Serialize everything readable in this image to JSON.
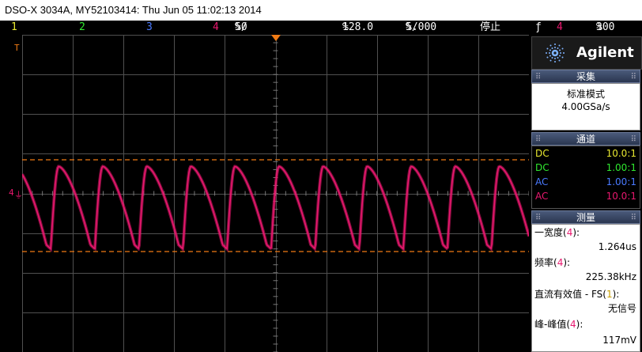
{
  "window": {
    "title": "DSO-X 3034A, MY52103414: Thu Jun 05 11:02:13 2014"
  },
  "status": {
    "ch1": "1",
    "ch2": "2",
    "ch3": "3",
    "ch4": "4",
    "ch4_scale": "50",
    "ch4_scale_unit": "%/",
    "time_delay": "128.0",
    "time_delay_unit": "%",
    "time_scale": "5.000",
    "time_scale_unit": "%/",
    "run_state": "停止",
    "trigger_symbol": "ƒ",
    "trigger_channel": "4",
    "trigger_level": "300",
    "trigger_level_unit": "%"
  },
  "colors": {
    "ch1": "#e8e830",
    "ch2": "#30e830",
    "ch3": "#4a7aff",
    "ch4": "#e8186e",
    "cursor": "#f07a14",
    "grid": "#505050"
  },
  "panel": {
    "brand": "Agilent",
    "acquire": {
      "header": "采集",
      "mode": "标准模式",
      "rate": "4.00GSa/s"
    },
    "channels": {
      "header": "通道",
      "rows": [
        {
          "coupling": "DC",
          "probe": "10.0:1"
        },
        {
          "coupling": "DC",
          "probe": "1.00:1"
        },
        {
          "coupling": "AC",
          "probe": "1.00:1"
        },
        {
          "coupling": "AC",
          "probe": "10.0:1"
        }
      ]
    },
    "measure": {
      "header": "测量",
      "items": [
        {
          "name": "一宽度(",
          "ch": "4",
          "close": "):",
          "value": "1.264us"
        },
        {
          "name": "频率(",
          "ch": "4",
          "close": "):",
          "value": "225.38kHz"
        },
        {
          "name": "直流有效值 - FS(",
          "ch": "1",
          "close": "):",
          "value": "无信号"
        },
        {
          "name": "峰-峰值(",
          "ch": "4",
          "close": "):",
          "value": "117mV"
        }
      ]
    }
  },
  "waveform": {
    "channel": "4",
    "description_cycles": 11.5,
    "peak_fraction": 0.58,
    "trough_fraction": 0.96
  },
  "markers": {
    "trigger_t": "T",
    "ground_marker": "4"
  }
}
